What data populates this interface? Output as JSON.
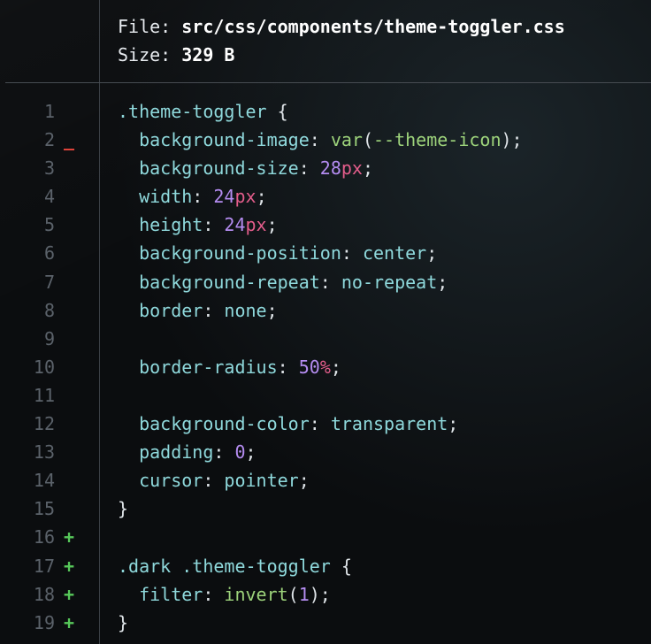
{
  "header": {
    "file_label": "File:",
    "file_path": "src/css/components/theme-toggler.css",
    "size_label": "Size:",
    "size_value": "329 B"
  },
  "colors": {
    "background": "#0b0d0f",
    "line_number": "#5b626a",
    "added_marker": "#57c85a",
    "removed_marker": "#e8453c",
    "property": "#8fd9dc",
    "function": "#9dd37b",
    "number": "#b48cf0",
    "unit": "#e35d8b"
  },
  "lines": [
    {
      "n": "1",
      "mark": "",
      "tokens": [
        {
          "t": ".theme-toggler",
          "c": "sel"
        },
        {
          "t": " {",
          "c": "punc"
        }
      ]
    },
    {
      "n": "2",
      "mark": "_",
      "tokens": [
        {
          "t": "  background-image",
          "c": "prop"
        },
        {
          "t": ": ",
          "c": "punc"
        },
        {
          "t": "var",
          "c": "fn"
        },
        {
          "t": "(",
          "c": "punc"
        },
        {
          "t": "--theme-icon",
          "c": "ident"
        },
        {
          "t": ");",
          "c": "punc"
        }
      ]
    },
    {
      "n": "3",
      "mark": "",
      "tokens": [
        {
          "t": "  background-size",
          "c": "prop"
        },
        {
          "t": ": ",
          "c": "punc"
        },
        {
          "t": "28",
          "c": "num"
        },
        {
          "t": "px",
          "c": "unit"
        },
        {
          "t": ";",
          "c": "punc"
        }
      ]
    },
    {
      "n": "4",
      "mark": "",
      "tokens": [
        {
          "t": "  width",
          "c": "prop"
        },
        {
          "t": ": ",
          "c": "punc"
        },
        {
          "t": "24",
          "c": "num"
        },
        {
          "t": "px",
          "c": "unit"
        },
        {
          "t": ";",
          "c": "punc"
        }
      ]
    },
    {
      "n": "5",
      "mark": "",
      "tokens": [
        {
          "t": "  height",
          "c": "prop"
        },
        {
          "t": ": ",
          "c": "punc"
        },
        {
          "t": "24",
          "c": "num"
        },
        {
          "t": "px",
          "c": "unit"
        },
        {
          "t": ";",
          "c": "punc"
        }
      ]
    },
    {
      "n": "6",
      "mark": "",
      "tokens": [
        {
          "t": "  background-position",
          "c": "prop"
        },
        {
          "t": ": ",
          "c": "punc"
        },
        {
          "t": "center",
          "c": "kw"
        },
        {
          "t": ";",
          "c": "punc"
        }
      ]
    },
    {
      "n": "7",
      "mark": "",
      "tokens": [
        {
          "t": "  background-repeat",
          "c": "prop"
        },
        {
          "t": ": ",
          "c": "punc"
        },
        {
          "t": "no-repeat",
          "c": "kw"
        },
        {
          "t": ";",
          "c": "punc"
        }
      ]
    },
    {
      "n": "8",
      "mark": "",
      "tokens": [
        {
          "t": "  border",
          "c": "prop"
        },
        {
          "t": ": ",
          "c": "punc"
        },
        {
          "t": "none",
          "c": "kw"
        },
        {
          "t": ";",
          "c": "punc"
        }
      ]
    },
    {
      "n": "9",
      "mark": "",
      "tokens": []
    },
    {
      "n": "10",
      "mark": "",
      "tokens": [
        {
          "t": "  border-radius",
          "c": "prop"
        },
        {
          "t": ": ",
          "c": "punc"
        },
        {
          "t": "50",
          "c": "num"
        },
        {
          "t": "%",
          "c": "unit"
        },
        {
          "t": ";",
          "c": "punc"
        }
      ]
    },
    {
      "n": "11",
      "mark": "",
      "tokens": []
    },
    {
      "n": "12",
      "mark": "",
      "tokens": [
        {
          "t": "  background-color",
          "c": "prop"
        },
        {
          "t": ": ",
          "c": "punc"
        },
        {
          "t": "transparent",
          "c": "kw"
        },
        {
          "t": ";",
          "c": "punc"
        }
      ]
    },
    {
      "n": "13",
      "mark": "",
      "tokens": [
        {
          "t": "  padding",
          "c": "prop"
        },
        {
          "t": ": ",
          "c": "punc"
        },
        {
          "t": "0",
          "c": "num"
        },
        {
          "t": ";",
          "c": "punc"
        }
      ]
    },
    {
      "n": "14",
      "mark": "",
      "tokens": [
        {
          "t": "  cursor",
          "c": "prop"
        },
        {
          "t": ": ",
          "c": "punc"
        },
        {
          "t": "pointer",
          "c": "kw"
        },
        {
          "t": ";",
          "c": "punc"
        }
      ]
    },
    {
      "n": "15",
      "mark": "",
      "tokens": [
        {
          "t": "}",
          "c": "punc"
        }
      ]
    },
    {
      "n": "16",
      "mark": "+",
      "tokens": []
    },
    {
      "n": "17",
      "mark": "+",
      "tokens": [
        {
          "t": ".dark .theme-toggler",
          "c": "sel"
        },
        {
          "t": " {",
          "c": "punc"
        }
      ]
    },
    {
      "n": "18",
      "mark": "+",
      "tokens": [
        {
          "t": "  filter",
          "c": "prop"
        },
        {
          "t": ": ",
          "c": "punc"
        },
        {
          "t": "invert",
          "c": "fn"
        },
        {
          "t": "(",
          "c": "punc"
        },
        {
          "t": "1",
          "c": "num"
        },
        {
          "t": ");",
          "c": "punc"
        }
      ]
    },
    {
      "n": "19",
      "mark": "+",
      "tokens": [
        {
          "t": "}",
          "c": "punc"
        }
      ]
    }
  ]
}
